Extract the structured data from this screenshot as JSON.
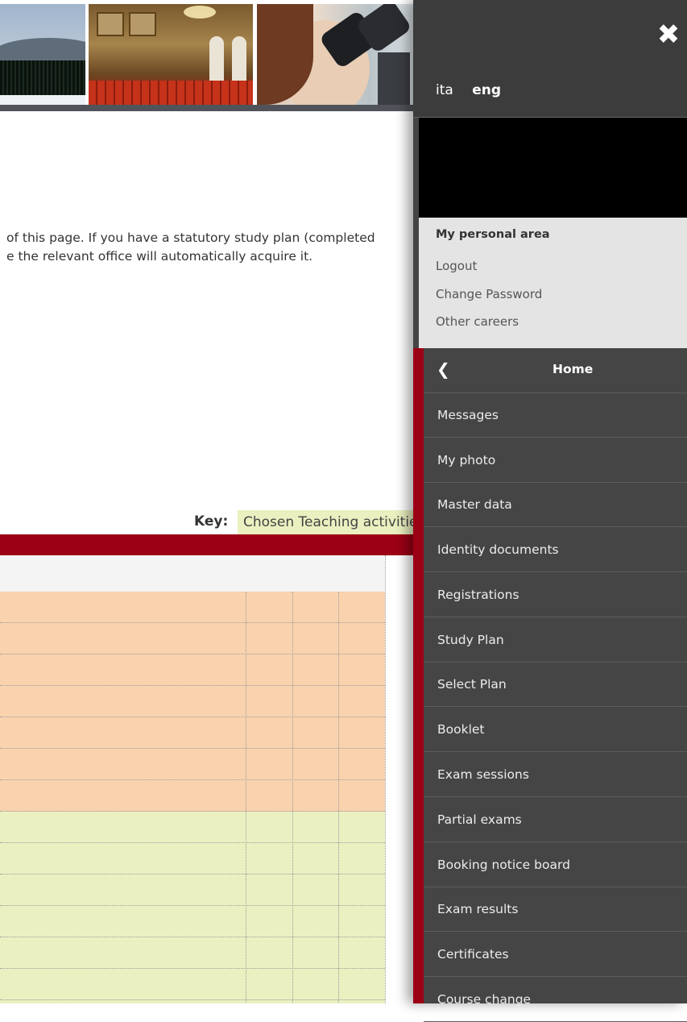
{
  "intro": {
    "line1": "of this page. If you have a statutory study plan (completed",
    "line2": "e the relevant office will automatically acquire it."
  },
  "key": {
    "label": "Key:",
    "swatch_text": "Chosen Teaching activities",
    "swatch_color": "#eaf0c0"
  },
  "colors": {
    "accent_red": "#9c0015",
    "menu_bg": "#454545",
    "row_orange": "#f9d3ad",
    "row_green": "#ebf0c1"
  },
  "sidemenu": {
    "close_icon": "close-icon",
    "languages": [
      "ita",
      "eng"
    ],
    "active_language": "eng",
    "personal_area": {
      "title": "My personal area",
      "links": [
        "Logout",
        "Change Password",
        "Other careers"
      ]
    },
    "home_label": "Home",
    "items": [
      "Messages",
      "My photo",
      "Master data",
      "Identity documents",
      "Registrations",
      "Study Plan",
      "Select Plan",
      "Booklet",
      "Exam sessions",
      "Partial exams",
      "Booking notice board",
      "Exam results",
      "Certificates",
      "Course change"
    ]
  }
}
